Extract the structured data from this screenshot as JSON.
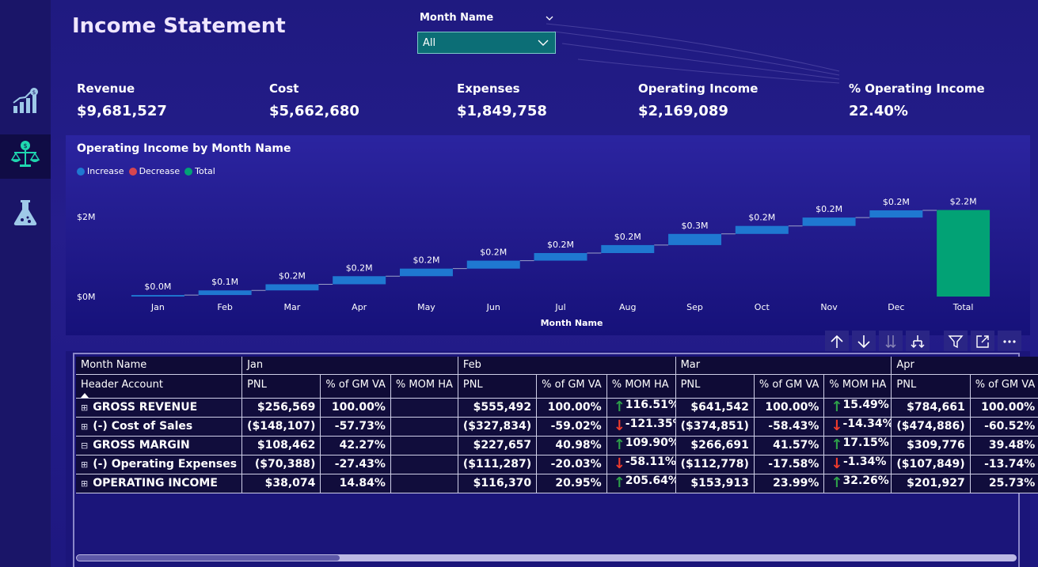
{
  "title": "Income Statement",
  "slicer": {
    "label": "Month Name",
    "value": "All"
  },
  "kpis": [
    {
      "label": "Revenue",
      "value": "$9,681,527"
    },
    {
      "label": "Cost",
      "value": "$5,662,680"
    },
    {
      "label": "Expenses",
      "value": "$1,849,758"
    },
    {
      "label": "Operating Income",
      "value": "$2,169,089"
    },
    {
      "label": "% Operating Income",
      "value": "22.40%"
    }
  ],
  "nav": {
    "items": [
      "chart-growth-icon",
      "balance-scale-icon",
      "flask-icon"
    ],
    "active": 1
  },
  "colors": {
    "increase": "#1f78d1",
    "decrease": "#d64550",
    "total": "#02a275",
    "up_arrow": "#2ea04a",
    "down_arrow": "#ef3b2c"
  },
  "chart_data": {
    "type": "waterfall",
    "title": "Operating Income by Month Name",
    "xlabel": "Month Name",
    "ylabel": "",
    "legend": [
      "Increase",
      "Decrease",
      "Total"
    ],
    "y_ticks": [
      "$0M",
      "$2M"
    ],
    "ylim": [
      0,
      2.2
    ],
    "categories": [
      "Jan",
      "Feb",
      "Mar",
      "Apr",
      "May",
      "Jun",
      "Jul",
      "Aug",
      "Sep",
      "Oct",
      "Nov",
      "Dec",
      "Total"
    ],
    "values": [
      0.038,
      0.116,
      0.154,
      0.202,
      0.19,
      0.2,
      0.19,
      0.2,
      0.28,
      0.2,
      0.21,
      0.181,
      2.169
    ],
    "labels": [
      "$0.0M",
      "$0.1M",
      "$0.2M",
      "$0.2M",
      "$0.2M",
      "$0.2M",
      "$0.2M",
      "$0.2M",
      "$0.3M",
      "$0.2M",
      "$0.2M",
      "$0.2M",
      "$2.2M"
    ],
    "kinds": [
      "increase",
      "increase",
      "increase",
      "increase",
      "increase",
      "increase",
      "increase",
      "increase",
      "increase",
      "increase",
      "increase",
      "increase",
      "total"
    ]
  },
  "toolbar": [
    "sort-up-icon",
    "sort-down-icon",
    "expand-all-icon",
    "drill-down-icon",
    "filter-icon",
    "focus-mode-icon",
    "more-options-icon"
  ],
  "table": {
    "corner1": "Month Name",
    "corner2": "Header Account",
    "months": [
      "Jan",
      "Feb",
      "Mar",
      "Apr"
    ],
    "measures": [
      "PNL",
      "% of GM VA",
      "% MOM HA"
    ],
    "rows": [
      {
        "account": "GROSS REVENUE",
        "expander": "⊞",
        "cells": [
          "$256,569",
          "100.00%",
          "",
          "$555,492",
          "100.00%",
          "116.51%",
          "$641,542",
          "100.00%",
          "15.49%",
          "$784,661",
          "100.00%"
        ],
        "arrows": [
          "",
          "up",
          "up"
        ]
      },
      {
        "account": "(-) Cost of Sales",
        "expander": "⊞",
        "cells": [
          "($148,107)",
          "-57.73%",
          "",
          "($327,834)",
          "-59.02%",
          "-121.35%",
          "($374,851)",
          "-58.43%",
          "-14.34%",
          "($474,886)",
          "-60.52%"
        ],
        "arrows": [
          "",
          "down",
          "down"
        ]
      },
      {
        "account": "GROSS MARGIN",
        "expander": "⊟",
        "cells": [
          "$108,462",
          "42.27%",
          "",
          "$227,657",
          "40.98%",
          "109.90%",
          "$266,691",
          "41.57%",
          "17.15%",
          "$309,776",
          "39.48%"
        ],
        "arrows": [
          "",
          "up",
          "up"
        ]
      },
      {
        "account": "(-) Operating Expenses",
        "expander": "⊞",
        "cells": [
          "($70,388)",
          "-27.43%",
          "",
          "($111,287)",
          "-20.03%",
          "-58.11%",
          "($112,778)",
          "-17.58%",
          "-1.34%",
          "($107,849)",
          "-13.74%"
        ],
        "arrows": [
          "",
          "down",
          "down"
        ]
      },
      {
        "account": "OPERATING INCOME",
        "expander": "⊞",
        "cells": [
          "$38,074",
          "14.84%",
          "",
          "$116,370",
          "20.95%",
          "205.64%",
          "$153,913",
          "23.99%",
          "32.26%",
          "$201,927",
          "25.73%"
        ],
        "arrows": [
          "",
          "up",
          "up"
        ]
      }
    ]
  }
}
